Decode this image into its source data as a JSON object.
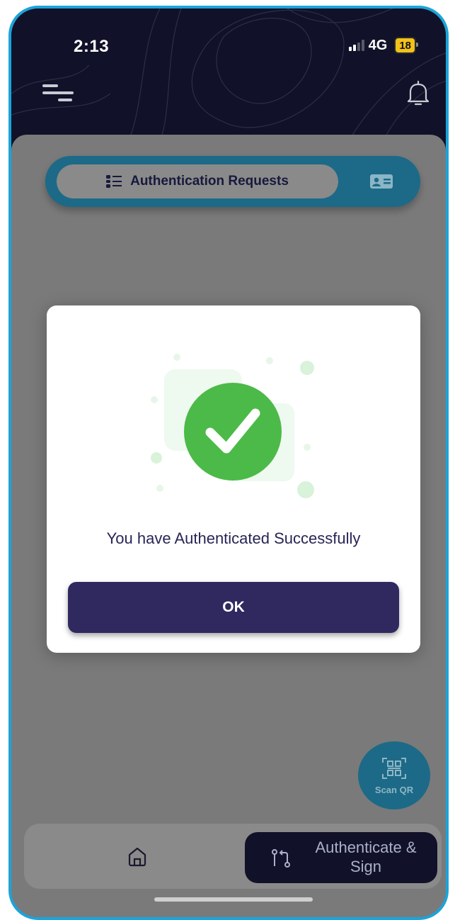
{
  "status_bar": {
    "time": "2:13",
    "network": "4G",
    "battery": "18"
  },
  "header": {
    "menu_icon": "hamburger-menu-icon",
    "notification_icon": "bell-icon"
  },
  "tabs": {
    "active_label": "Authentication Requests",
    "active_icon": "list-icon",
    "secondary_icon": "id-card-icon"
  },
  "modal": {
    "icon": "check-circle-icon",
    "message": "You have Authenticated Successfully",
    "ok_label": "OK"
  },
  "scan_qr": {
    "icon": "qr-scan-icon",
    "label": "Scan QR"
  },
  "bottom_nav": {
    "home_icon": "home-icon",
    "auth_sign_icon": "git-compare-icon",
    "auth_sign_label": "Authenticate & Sign"
  },
  "colors": {
    "header_bg": "#111129",
    "accent": "#1aa4d9",
    "tab_bg": "#1c6a87",
    "button": "#2f2960",
    "success": "#4cba48"
  }
}
